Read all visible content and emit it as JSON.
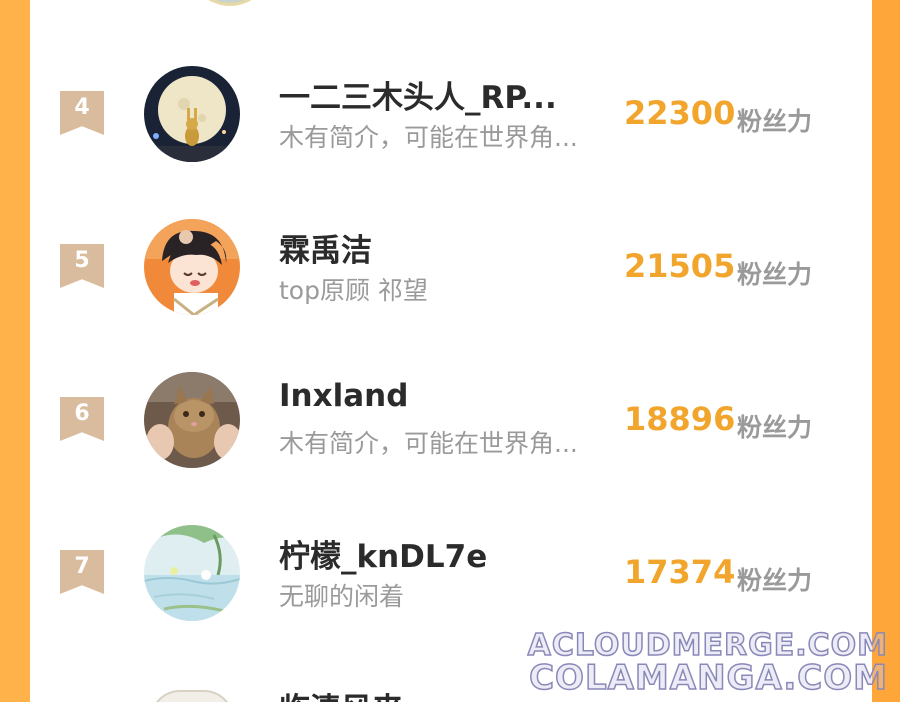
{
  "leaderboard": {
    "score_unit": "粉丝力",
    "rows": [
      {
        "rank": "4",
        "name": "一二三木头人_RP...",
        "bio": "木有简介，可能在世界角...",
        "score": "22300"
      },
      {
        "rank": "5",
        "name": "霖禹洁",
        "bio": "top原顾 祁望",
        "score": "21505"
      },
      {
        "rank": "6",
        "name": "Inxland",
        "bio": "木有简介，可能在世界角...",
        "score": "18896"
      },
      {
        "rank": "7",
        "name": "柠檬_knDL7e",
        "bio": "无聊的闲着",
        "score": "17374"
      }
    ],
    "partial_next_name": "临清风来"
  },
  "watermark": {
    "line1": "ACLOUDMERGE.COM",
    "line2": "COLAMANGA.COM"
  },
  "colors": {
    "background": "#ffa63a",
    "score": "#f2a52c",
    "rank_badge": "#d9bc9e",
    "name": "#2b2b2b",
    "secondary_text": "#9a9a9a"
  }
}
